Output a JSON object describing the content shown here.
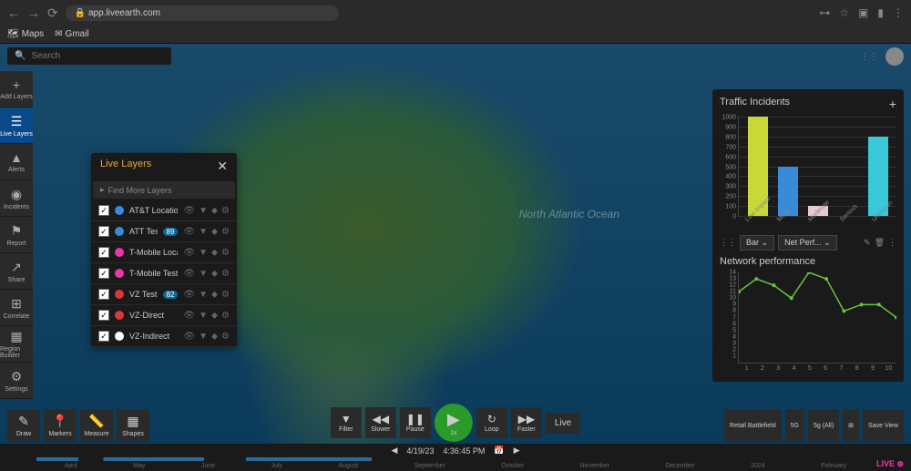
{
  "browser": {
    "url": "app.liveearth.com",
    "bookmarks": [
      "Maps",
      "Gmail"
    ]
  },
  "search": {
    "placeholder": "Search"
  },
  "mapLabel": "North Atlantic Ocean",
  "sidebar": {
    "items": [
      {
        "icon": "+",
        "label": "Add Layers"
      },
      {
        "icon": "☰",
        "label": "Live Layers",
        "active": true
      },
      {
        "icon": "▲",
        "label": "Alerts"
      },
      {
        "icon": "◉",
        "label": "Incidents"
      },
      {
        "icon": "⚑",
        "label": "Report"
      },
      {
        "icon": "↗",
        "label": "Share"
      },
      {
        "icon": "⊞",
        "label": "Correlate"
      },
      {
        "icon": "▦",
        "label": "Region Builder"
      },
      {
        "icon": "⚙",
        "label": "Settings"
      }
    ]
  },
  "layersPanel": {
    "title": "Live Layers",
    "searchLabel": "Find More Layers",
    "items": [
      {
        "checked": true,
        "color": "#3a8ada",
        "name": "AT&T Locations",
        "badge": null
      },
      {
        "checked": true,
        "color": "#3a8ada",
        "name": "ATT Test Data",
        "badge": "89"
      },
      {
        "checked": true,
        "color": "#e838a8",
        "name": "T-Mobile Locatic",
        "badge": null
      },
      {
        "checked": true,
        "color": "#e838a8",
        "name": "T-Mobile Test Da",
        "badge": null
      },
      {
        "checked": true,
        "color": "#d83838",
        "name": "VZ Test Data",
        "badge": "82"
      },
      {
        "checked": true,
        "color": "#d83838",
        "name": "VZ-Direct",
        "badge": null
      },
      {
        "checked": true,
        "color": "#ffffff",
        "name": "VZ-Indirect",
        "badge": null
      }
    ]
  },
  "chart_data": [
    {
      "type": "bar",
      "title": "Traffic Incidents",
      "categories": [
        "Low Impact",
        "Minor",
        "Moderate",
        "Serious",
        "Unknown"
      ],
      "values": [
        1000,
        500,
        100,
        0,
        800
      ],
      "ylim": [
        0,
        1000
      ],
      "yticks": [
        0,
        100,
        200,
        300,
        400,
        500,
        600,
        700,
        800,
        900,
        1000
      ],
      "colorMode": "perBar",
      "colors": [
        "#c8d838",
        "#3a8ada",
        "#e8c8d8",
        "#888",
        "#38c8d8"
      ]
    },
    {
      "type": "line",
      "title": "Network performance",
      "x": [
        1,
        2,
        3,
        4,
        5,
        6,
        7,
        8,
        9,
        10
      ],
      "values": [
        11,
        13,
        12,
        10,
        14,
        13,
        8,
        9,
        9,
        7
      ],
      "ylim": [
        0,
        14
      ],
      "yticks": [
        1,
        2,
        3,
        4,
        5,
        6,
        7,
        8,
        9,
        10,
        11,
        12,
        13,
        14
      ],
      "color": "#6ac838"
    }
  ],
  "chartControls": {
    "type": "Bar",
    "select2": "Net Perf..."
  },
  "bottomTools": [
    {
      "icon": "✎",
      "label": "Draw"
    },
    {
      "icon": "📍",
      "label": "Markers"
    },
    {
      "icon": "📏",
      "label": "Measure"
    },
    {
      "icon": "▦",
      "label": "Shapes"
    }
  ],
  "playback": {
    "buttons": [
      {
        "icon": "▼",
        "label": "Filter"
      },
      {
        "icon": "◀◀",
        "label": "Slower"
      },
      {
        "icon": "❚❚",
        "label": "Pause"
      },
      {
        "icon": "▶",
        "label": "",
        "cls": "play"
      },
      {
        "icon": "↻",
        "label": "Loop"
      },
      {
        "icon": "▶▶",
        "label": "Faster"
      }
    ],
    "speed": "1x",
    "live": "Live",
    "date": "4/19/23",
    "time": "4:36:45 PM"
  },
  "rightBottom": [
    {
      "label": "Retail Battlefield"
    },
    {
      "label": "5G"
    },
    {
      "label": "5g (All)"
    },
    {
      "label": "⊞"
    },
    {
      "label": "Save View"
    }
  ],
  "timeline": {
    "months": [
      "April",
      "May",
      "June",
      "July",
      "August",
      "September",
      "October",
      "November",
      "December",
      "2024",
      "February"
    ]
  },
  "logo": "LIVE ⊕"
}
